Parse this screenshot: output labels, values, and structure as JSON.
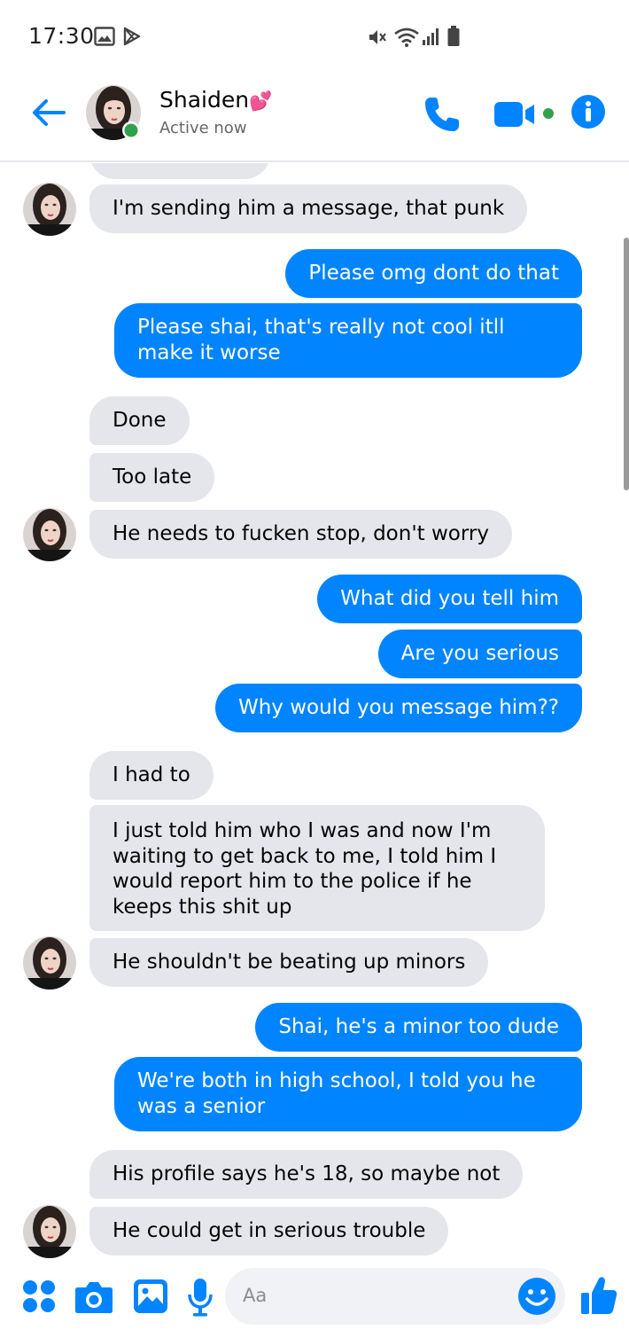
{
  "status_bar": {
    "time": "17:30"
  },
  "header": {
    "contact_name": "Shaiden",
    "name_emoji": "💕",
    "active_status": "Active now"
  },
  "messages": [
    {
      "sender": "them",
      "text": "I'm sending him a message, that punk"
    },
    {
      "sender": "me",
      "text": "Please omg dont do that"
    },
    {
      "sender": "me",
      "text": "Please shai, that's really not cool itll make it worse"
    },
    {
      "sender": "them",
      "text": "Done"
    },
    {
      "sender": "them",
      "text": "Too late"
    },
    {
      "sender": "them",
      "text": "He needs to fucken stop, don't worry"
    },
    {
      "sender": "me",
      "text": "What did you tell him"
    },
    {
      "sender": "me",
      "text": "Are you serious"
    },
    {
      "sender": "me",
      "text": "Why would you message him??"
    },
    {
      "sender": "them",
      "text": "I had to"
    },
    {
      "sender": "them",
      "text": "I just told him who I was and now I'm waiting to get back to me, I told him I would report him to the police if he keeps this shit up"
    },
    {
      "sender": "them",
      "text": "He shouldn't be beating up minors"
    },
    {
      "sender": "me",
      "text": "Shai, he's a minor too dude"
    },
    {
      "sender": "me",
      "text": "We're both in high school, I told you he was a senior"
    },
    {
      "sender": "them",
      "text": "His profile says he's 18, so maybe not"
    },
    {
      "sender": "them",
      "text": "He could get in serious trouble"
    }
  ],
  "composer": {
    "placeholder": "Aa"
  },
  "colors": {
    "accent": "#0084ff",
    "incoming_bubble": "#e4e6eb",
    "online_dot": "#31a24c"
  }
}
